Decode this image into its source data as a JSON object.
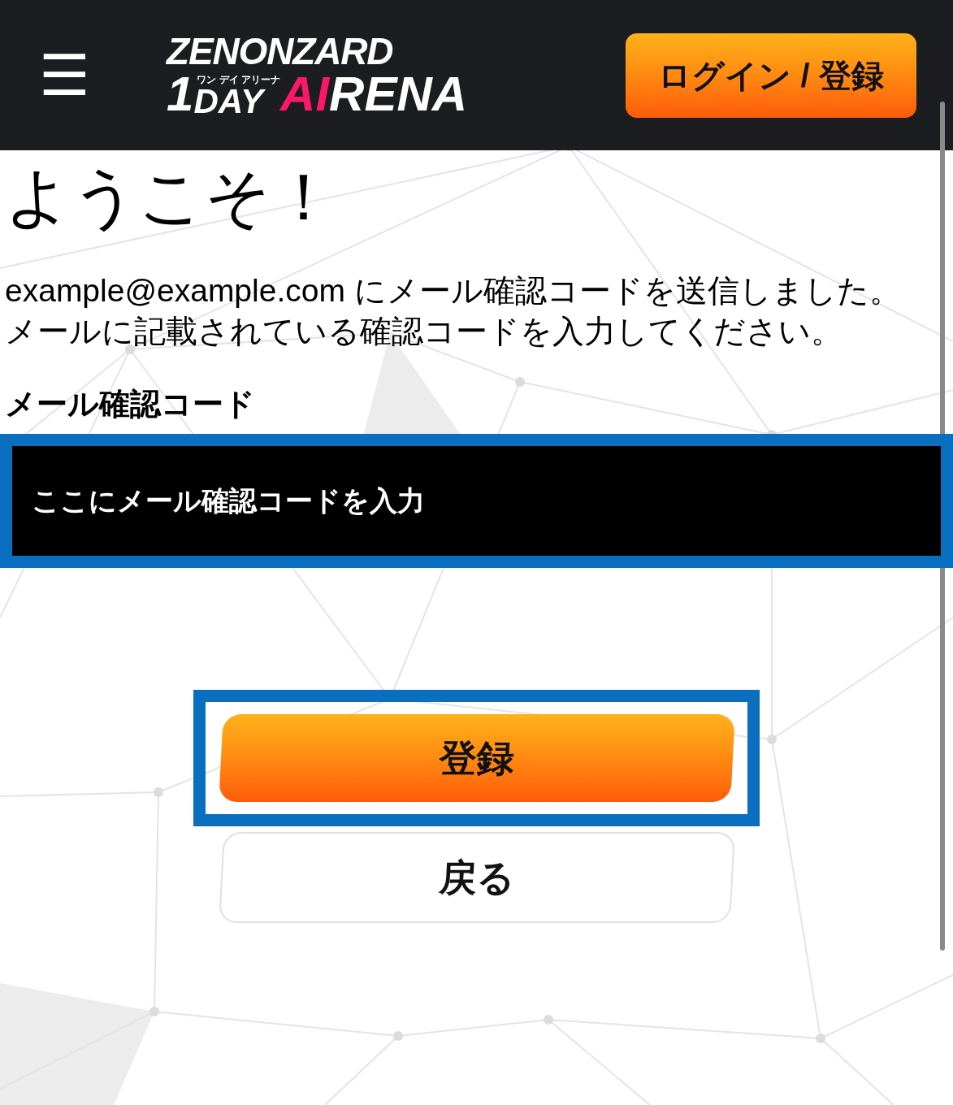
{
  "header": {
    "menu_label": "☰",
    "logo": {
      "top": "ZENONZARD",
      "digit": "1",
      "ruby": "ワン デイ アリーナ",
      "left": "DAY",
      "accent": "AI",
      "right": "RENA"
    },
    "login_button": "ログイン / 登録"
  },
  "heading": "ようこそ！",
  "message": [
    "example@example.com にメール確認コードを送信しました。",
    "メールに記載されている確認コードを入力してください。"
  ],
  "code_field": {
    "label": "メール確認コード",
    "placeholder": "ここにメール確認コードを入力",
    "highlighted": true
  },
  "submit_button": {
    "label": "登録",
    "highlighted": true
  },
  "back_button": {
    "label": "戻る"
  }
}
